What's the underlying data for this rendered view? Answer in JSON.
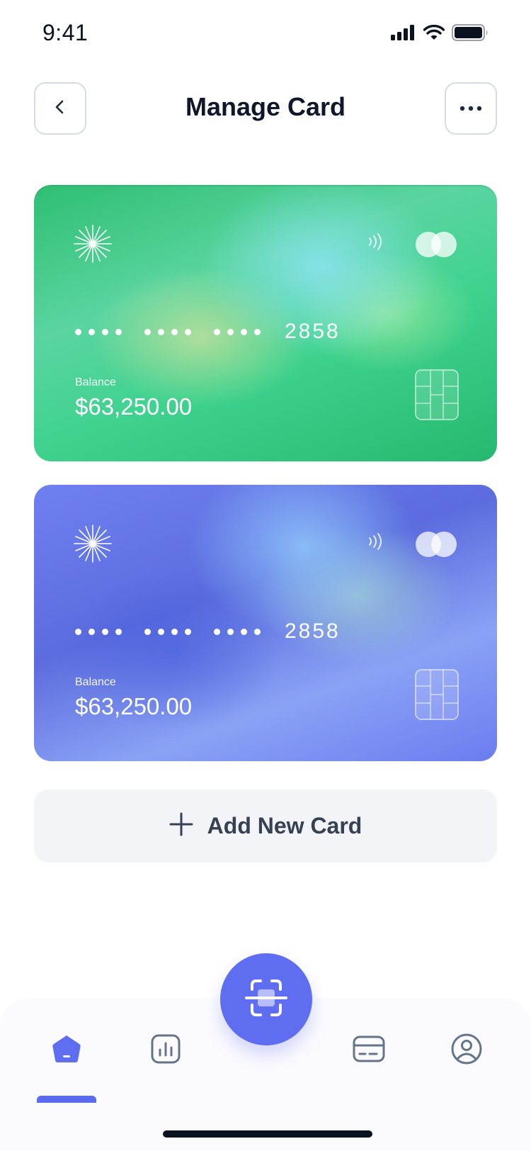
{
  "status_bar": {
    "time": "9:41",
    "icons": [
      "signal-icon",
      "wifi-icon",
      "battery-icon"
    ]
  },
  "header": {
    "title": "Manage Card",
    "back_icon": "chevron-left-icon",
    "more_icon": "more-horizontal-icon"
  },
  "cards": [
    {
      "theme": "green",
      "accent": "#2fbe73",
      "masked_groups": [
        "••••",
        "••••",
        "••••"
      ],
      "last4": "2858",
      "balance_label": "Balance",
      "balance": "$63,250.00",
      "network_icon": "mastercard-icon",
      "contactless_icon": "contactless-icon",
      "logo_icon": "starburst-logo-icon",
      "chip_icon": "chip-icon"
    },
    {
      "theme": "blue",
      "accent": "#6b7cf0",
      "masked_groups": [
        "••••",
        "••••",
        "••••"
      ],
      "last4": "2858",
      "balance_label": "Balance",
      "balance": "$63,250.00",
      "network_icon": "mastercard-icon",
      "contactless_icon": "contactless-icon",
      "logo_icon": "starburst-logo-icon",
      "chip_icon": "chip-icon"
    }
  ],
  "add_card": {
    "label": "Add New Card",
    "icon": "plus-icon"
  },
  "bottom_nav": {
    "items": [
      {
        "name": "home",
        "icon": "home-icon",
        "active": true
      },
      {
        "name": "statistics",
        "icon": "bar-chart-icon",
        "active": false
      },
      {
        "name": "scan",
        "icon": "scan-icon",
        "active": false
      },
      {
        "name": "cards",
        "icon": "credit-card-icon",
        "active": false
      },
      {
        "name": "profile",
        "icon": "user-circle-icon",
        "active": false
      }
    ],
    "accent_color": "#5f6df0"
  }
}
